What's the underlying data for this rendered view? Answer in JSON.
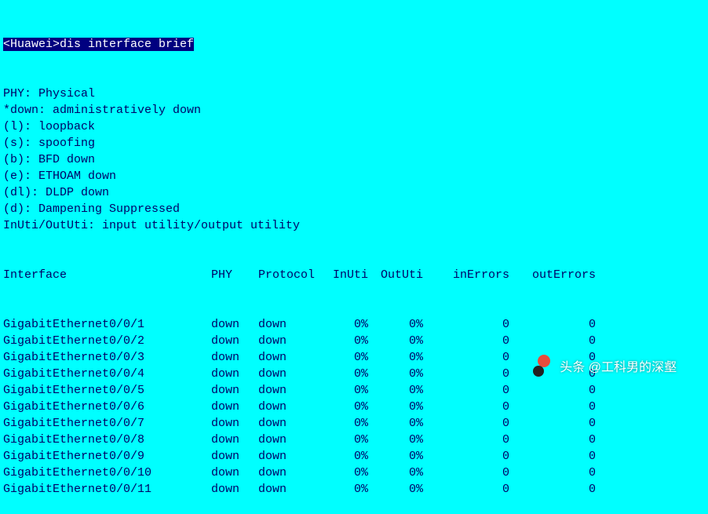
{
  "prompt": {
    "prefix": "<Huawei>",
    "command": "dis interface brief"
  },
  "legend": [
    "PHY: Physical",
    "*down: administratively down",
    "(l): loopback",
    "(s): spoofing",
    "(b): BFD down",
    "(e): ETHOAM down",
    "(dl): DLDP down",
    "(d): Dampening Suppressed",
    "InUti/OutUti: input utility/output utility"
  ],
  "headers": {
    "iface": "Interface",
    "phy": "PHY",
    "proto": "Protocol",
    "inuti": "InUti",
    "oututi": "OutUti",
    "inerr": "inErrors",
    "outerr": "outErrors"
  },
  "rows": [
    {
      "iface": "GigabitEthernet0/0/1",
      "phy": "down",
      "proto": "down",
      "inuti": "0%",
      "oututi": "0%",
      "inerr": "0",
      "outerr": "0"
    },
    {
      "iface": "GigabitEthernet0/0/2",
      "phy": "down",
      "proto": "down",
      "inuti": "0%",
      "oututi": "0%",
      "inerr": "0",
      "outerr": "0"
    },
    {
      "iface": "GigabitEthernet0/0/3",
      "phy": "down",
      "proto": "down",
      "inuti": "0%",
      "oututi": "0%",
      "inerr": "0",
      "outerr": "0"
    },
    {
      "iface": "GigabitEthernet0/0/4",
      "phy": "down",
      "proto": "down",
      "inuti": "0%",
      "oututi": "0%",
      "inerr": "0",
      "outerr": "0"
    },
    {
      "iface": "GigabitEthernet0/0/5",
      "phy": "down",
      "proto": "down",
      "inuti": "0%",
      "oututi": "0%",
      "inerr": "0",
      "outerr": "0"
    },
    {
      "iface": "GigabitEthernet0/0/6",
      "phy": "down",
      "proto": "down",
      "inuti": "0%",
      "oututi": "0%",
      "inerr": "0",
      "outerr": "0"
    },
    {
      "iface": "GigabitEthernet0/0/7",
      "phy": "down",
      "proto": "down",
      "inuti": "0%",
      "oututi": "0%",
      "inerr": "0",
      "outerr": "0"
    },
    {
      "iface": "GigabitEthernet0/0/8",
      "phy": "down",
      "proto": "down",
      "inuti": "0%",
      "oututi": "0%",
      "inerr": "0",
      "outerr": "0"
    },
    {
      "iface": "GigabitEthernet0/0/9",
      "phy": "down",
      "proto": "down",
      "inuti": "0%",
      "oututi": "0%",
      "inerr": "0",
      "outerr": "0"
    },
    {
      "iface": "GigabitEthernet0/0/10",
      "phy": "down",
      "proto": "down",
      "inuti": "0%",
      "oututi": "0%",
      "inerr": "0",
      "outerr": "0"
    },
    {
      "iface": "GigabitEthernet0/0/11",
      "phy": "down",
      "proto": "down",
      "inuti": "0%",
      "oututi": "0%",
      "inerr": "0",
      "outerr": "0"
    }
  ],
  "watermark": {
    "text": "头条 @工科男的深壑"
  }
}
